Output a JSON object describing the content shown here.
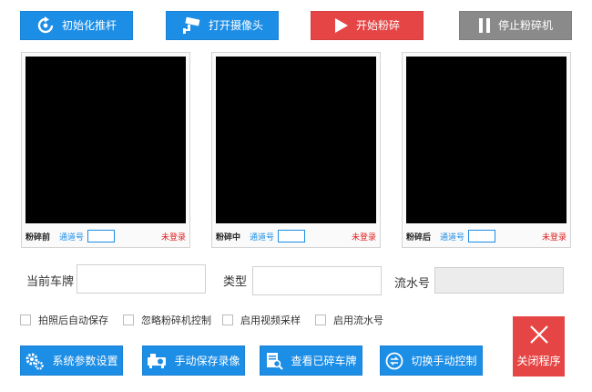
{
  "toolbar": {
    "init_push_rod": "初始化推杆",
    "open_camera": "打开摄像头",
    "start_shred": "开始粉碎",
    "stop_shredder": "停止粉碎机"
  },
  "panels": [
    {
      "name": "粉碎前",
      "channel_label": "通道号",
      "status": "未登录"
    },
    {
      "name": "粉碎中",
      "channel_label": "通道号",
      "status": "未登录"
    },
    {
      "name": "粉碎后",
      "channel_label": "通道号",
      "status": "未登录"
    }
  ],
  "fields": {
    "plate_label": "当前车牌",
    "plate_value": "",
    "type_label": "类型",
    "type_value": "",
    "serial_label": "流水号",
    "serial_value": ""
  },
  "options": [
    {
      "label": "拍照后自动保存",
      "checked": false
    },
    {
      "label": "忽略粉碎机控制",
      "checked": false
    },
    {
      "label": "启用视频采样",
      "checked": false
    },
    {
      "label": "启用流水号",
      "checked": false
    }
  ],
  "bottom": {
    "system_settings": "系统参数设置",
    "manual_record": "手动保存录像",
    "view_shredded": "查看已碎车牌",
    "switch_manual": "切换手动控制",
    "close_program": "关闭程序"
  },
  "colors": {
    "primary": "#1d8ee6",
    "danger": "#e64545",
    "muted": "#8a8a8a",
    "status_red": "#e02020"
  }
}
